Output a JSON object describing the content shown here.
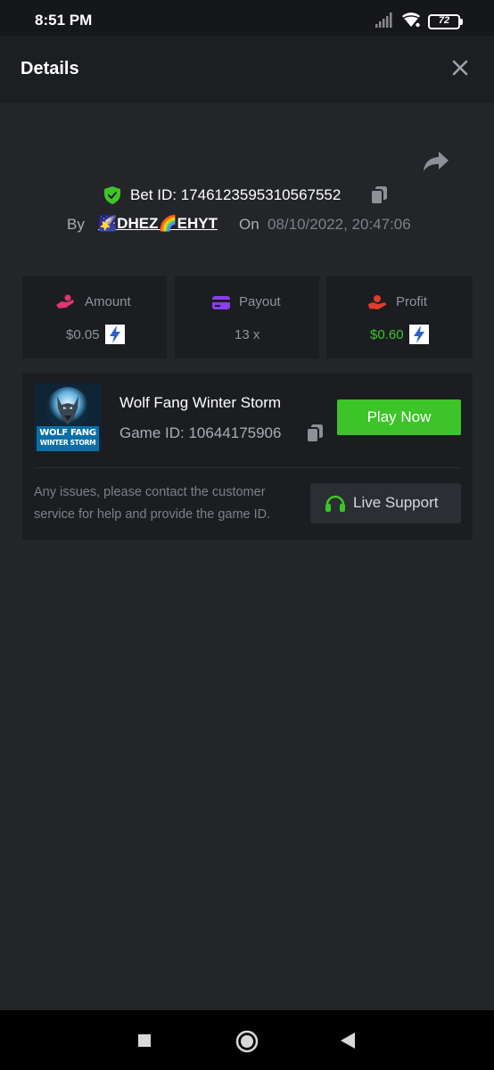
{
  "status_bar": {
    "time": "8:51 PM",
    "battery": "72"
  },
  "header": {
    "title": "Details"
  },
  "bet": {
    "id_label": "Bet ID:",
    "id_value": "1746123595310567552",
    "by_label": "By",
    "username": "🌠DHEZ🌈EHYT",
    "on_label": "On",
    "date": "08/10/2022, 20:47:06"
  },
  "stats": [
    {
      "label": "Amount",
      "value": "$0.05",
      "color": "#8f949b",
      "icon": "money-hand-icon",
      "icon_color": "#e0356d"
    },
    {
      "label": "Payout",
      "value": "13 x",
      "color": "#8f949b",
      "icon": "card-icon",
      "icon_color": "#8b3df0"
    },
    {
      "label": "Profit",
      "value": "$0.60",
      "color": "#3dc428",
      "icon": "profit-hand-icon",
      "icon_color": "#e23b2e"
    }
  ],
  "game": {
    "name": "Wolf Fang Winter Storm",
    "id_text": "Game ID: 10644175906",
    "thumb_line1": "WOLF FANG",
    "thumb_line2": "WINTER STORM",
    "play_label": "Play Now",
    "help_text": "Any issues, please contact the customer service for help and provide the game ID.",
    "support_label": "Live Support"
  },
  "colors": {
    "accent_green": "#3dc428",
    "background": "#232529",
    "card": "#1b1d21"
  }
}
